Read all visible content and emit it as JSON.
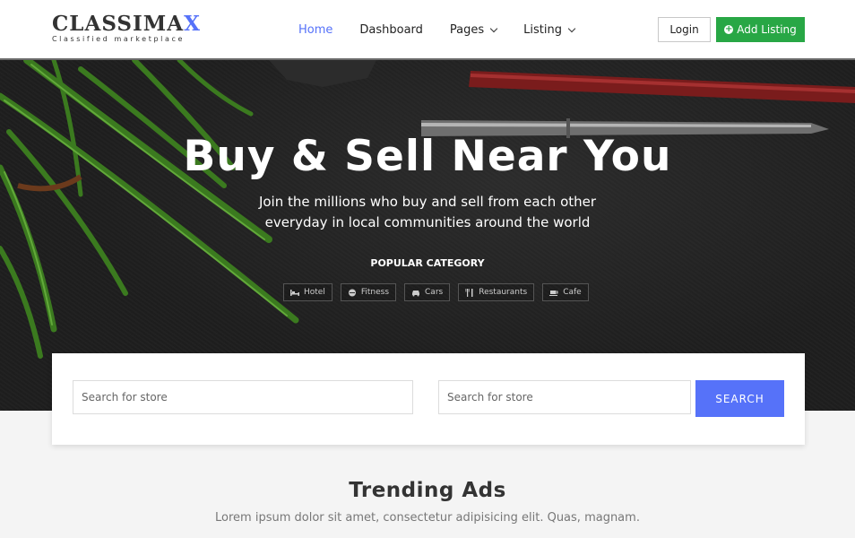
{
  "brand": {
    "name_main": "CLASSIMA",
    "name_accent": "X",
    "tagline": "Classified marketplace",
    "accent_color": "#5672f9"
  },
  "nav": {
    "items": [
      {
        "label": "Home",
        "active": true
      },
      {
        "label": "Dashboard"
      },
      {
        "label": "Pages",
        "dropdown": true
      },
      {
        "label": "Listing",
        "dropdown": true
      }
    ],
    "login_label": "Login",
    "add_listing_label": "Add Listing"
  },
  "hero": {
    "title": "Buy & Sell Near You",
    "subtitle_line1": "Join the millions who buy and sell from each other",
    "subtitle_line2": "everyday in local communities around the world",
    "popular_label": "POPULAR CATEGORY",
    "categories": [
      {
        "label": "Hotel",
        "icon": "bed-icon"
      },
      {
        "label": "Fitness",
        "icon": "fitness-icon"
      },
      {
        "label": "Cars",
        "icon": "car-icon"
      },
      {
        "label": "Restaurants",
        "icon": "cutlery-icon"
      },
      {
        "label": "Cafe",
        "icon": "coffee-icon"
      }
    ]
  },
  "search": {
    "placeholder1": "Search for store",
    "placeholder2": "Search for store",
    "button_label": "SEARCH"
  },
  "trending": {
    "title": "Trending Ads",
    "subtitle": "Lorem ipsum dolor sit amet, consectetur adipisicing elit. Quas, magnam."
  },
  "colors": {
    "primary": "#5672f9",
    "success": "#28a745"
  }
}
